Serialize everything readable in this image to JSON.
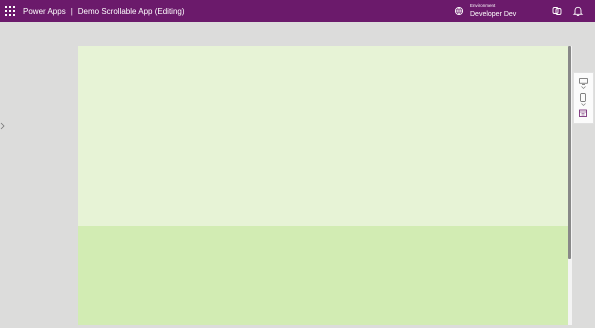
{
  "header": {
    "app_name": "Power Apps",
    "separator": "|",
    "app_title": "Demo Scrollable App (Editing)",
    "environment_label": "Environment",
    "environment_name": "Developer Dev"
  },
  "colors": {
    "header_bg": "#6b1a6b",
    "screen_top": "#e7f3d6",
    "screen_bottom": "#d2ecb3",
    "workspace_bg": "#dcdcdb"
  },
  "icons": {
    "app_launcher": "waffle-icon",
    "environment": "environment-icon",
    "copilot": "copilot-icon",
    "notifications": "bell-icon",
    "canvas_toolbox": [
      "monitor-icon",
      "phone-icon",
      "calendar-icon"
    ]
  }
}
